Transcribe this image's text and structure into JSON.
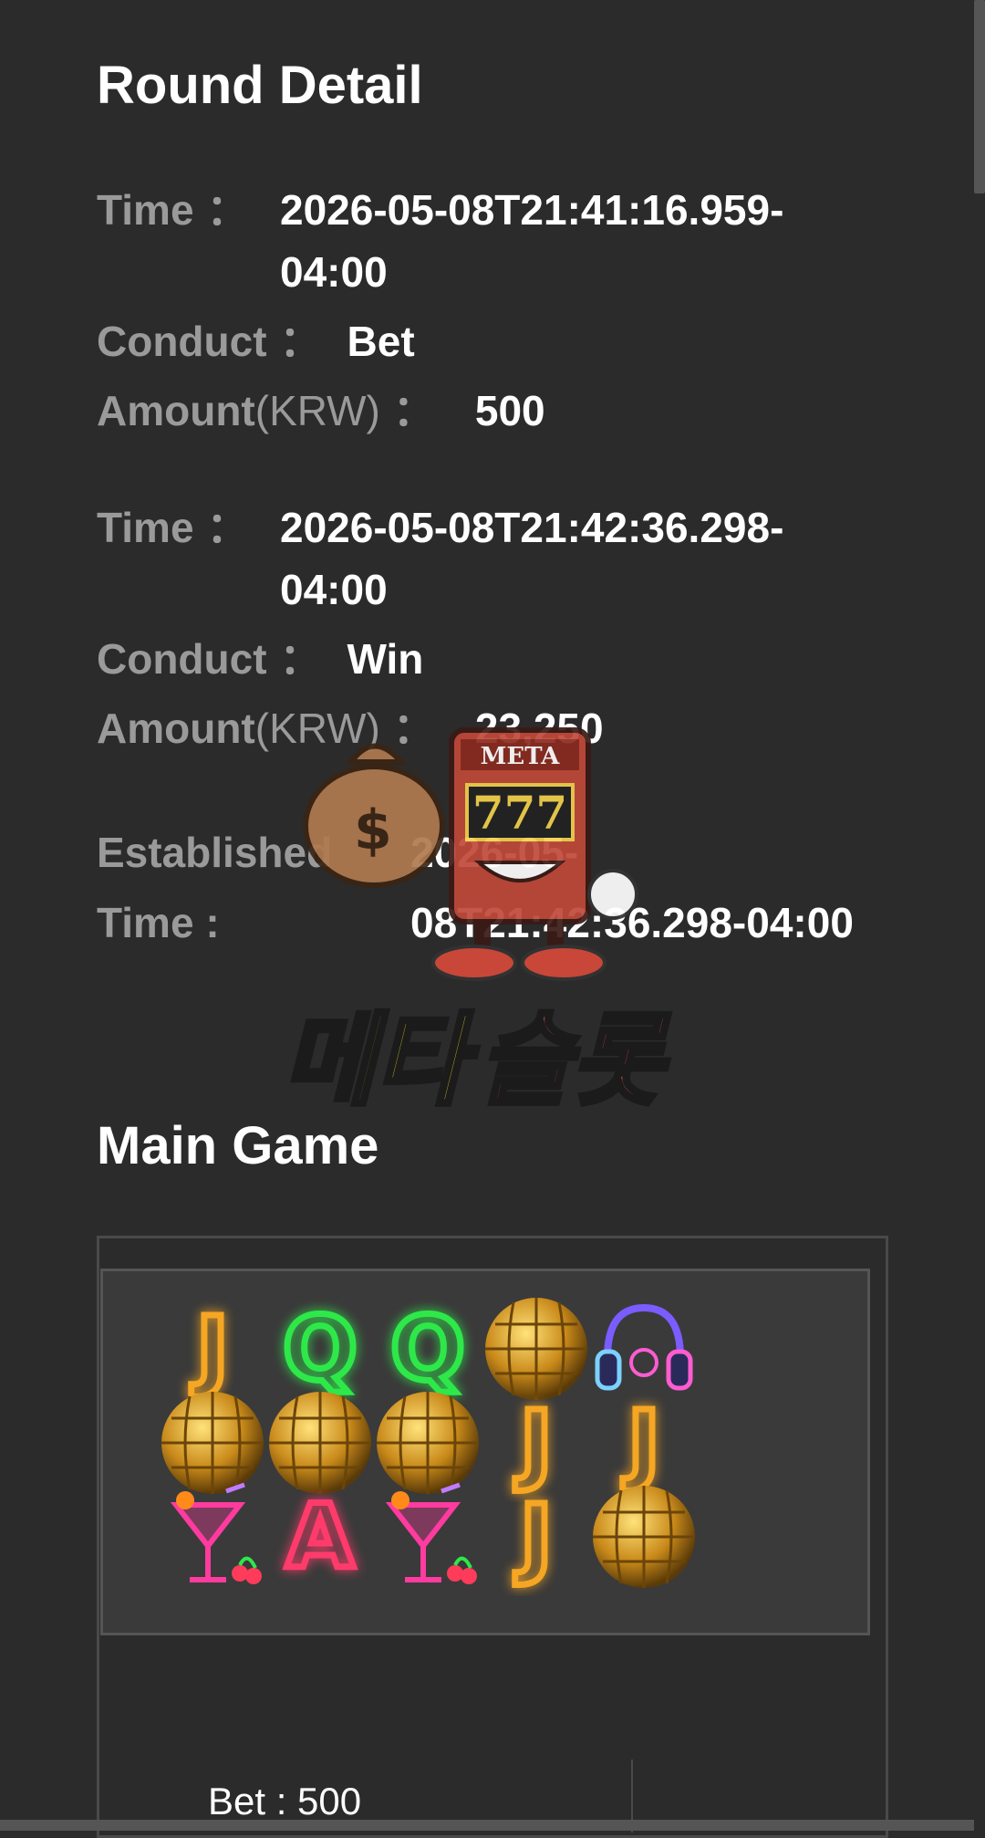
{
  "page": {
    "title": "Round Detail",
    "main_game_title": "Main Game"
  },
  "labels": {
    "time": "Time",
    "conduct": "Conduct",
    "amount": "Amount",
    "amount_unit": "(KRW)",
    "colon": "：",
    "established_1": "Established",
    "established_2": "Time :"
  },
  "records": [
    {
      "time_line1": "2026-05-08T21:41:16.959-",
      "time_line2": "04:00",
      "conduct": "Bet",
      "amount": "500"
    },
    {
      "time_line1": "2026-05-08T21:42:36.298-",
      "time_line2": "04:00",
      "conduct": "Win",
      "amount": "23,250"
    }
  ],
  "established": {
    "line1": "2026-05-",
    "line2": "08T21:42:36.298-04:00"
  },
  "reels": [
    [
      "J",
      "Q",
      "Q",
      "disco-ball",
      "headphones"
    ],
    [
      "disco-ball",
      "disco-ball",
      "disco-ball",
      "J",
      "J"
    ],
    [
      "cocktail",
      "A",
      "cocktail",
      "J",
      "disco-ball"
    ]
  ],
  "bet_line": "Bet : 500",
  "watermark": {
    "sign": "META",
    "reels": "777",
    "brand_part1": "메타",
    "brand_part2": "슬롯"
  },
  "colors": {
    "background": "#2b2b2b",
    "label": "#9a9a9a",
    "neon_gold": "#f5a623",
    "neon_green": "#2ee84a",
    "neon_pink": "#ff3b6b",
    "brand_yellow": "#c9c21a",
    "brand_red": "#c0493a"
  }
}
